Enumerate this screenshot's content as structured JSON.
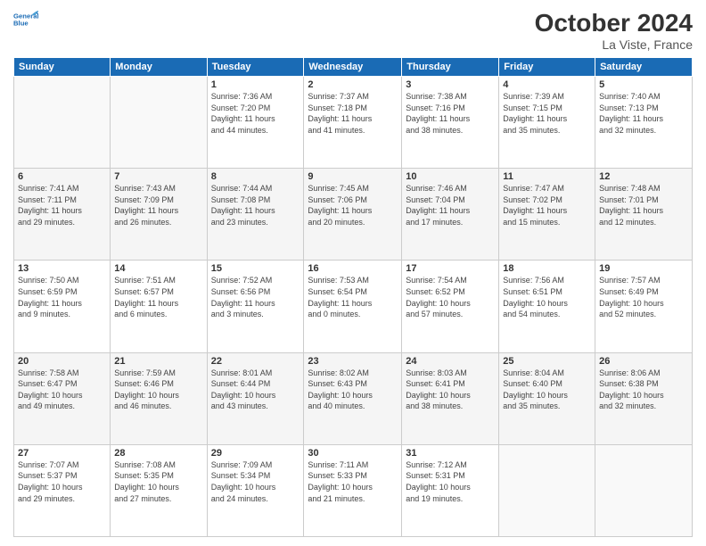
{
  "header": {
    "logo_line1": "General",
    "logo_line2": "Blue",
    "month": "October 2024",
    "location": "La Viste, France"
  },
  "days_of_week": [
    "Sunday",
    "Monday",
    "Tuesday",
    "Wednesday",
    "Thursday",
    "Friday",
    "Saturday"
  ],
  "weeks": [
    [
      {
        "num": "",
        "detail": ""
      },
      {
        "num": "",
        "detail": ""
      },
      {
        "num": "1",
        "detail": "Sunrise: 7:36 AM\nSunset: 7:20 PM\nDaylight: 11 hours\nand 44 minutes."
      },
      {
        "num": "2",
        "detail": "Sunrise: 7:37 AM\nSunset: 7:18 PM\nDaylight: 11 hours\nand 41 minutes."
      },
      {
        "num": "3",
        "detail": "Sunrise: 7:38 AM\nSunset: 7:16 PM\nDaylight: 11 hours\nand 38 minutes."
      },
      {
        "num": "4",
        "detail": "Sunrise: 7:39 AM\nSunset: 7:15 PM\nDaylight: 11 hours\nand 35 minutes."
      },
      {
        "num": "5",
        "detail": "Sunrise: 7:40 AM\nSunset: 7:13 PM\nDaylight: 11 hours\nand 32 minutes."
      }
    ],
    [
      {
        "num": "6",
        "detail": "Sunrise: 7:41 AM\nSunset: 7:11 PM\nDaylight: 11 hours\nand 29 minutes."
      },
      {
        "num": "7",
        "detail": "Sunrise: 7:43 AM\nSunset: 7:09 PM\nDaylight: 11 hours\nand 26 minutes."
      },
      {
        "num": "8",
        "detail": "Sunrise: 7:44 AM\nSunset: 7:08 PM\nDaylight: 11 hours\nand 23 minutes."
      },
      {
        "num": "9",
        "detail": "Sunrise: 7:45 AM\nSunset: 7:06 PM\nDaylight: 11 hours\nand 20 minutes."
      },
      {
        "num": "10",
        "detail": "Sunrise: 7:46 AM\nSunset: 7:04 PM\nDaylight: 11 hours\nand 17 minutes."
      },
      {
        "num": "11",
        "detail": "Sunrise: 7:47 AM\nSunset: 7:02 PM\nDaylight: 11 hours\nand 15 minutes."
      },
      {
        "num": "12",
        "detail": "Sunrise: 7:48 AM\nSunset: 7:01 PM\nDaylight: 11 hours\nand 12 minutes."
      }
    ],
    [
      {
        "num": "13",
        "detail": "Sunrise: 7:50 AM\nSunset: 6:59 PM\nDaylight: 11 hours\nand 9 minutes."
      },
      {
        "num": "14",
        "detail": "Sunrise: 7:51 AM\nSunset: 6:57 PM\nDaylight: 11 hours\nand 6 minutes."
      },
      {
        "num": "15",
        "detail": "Sunrise: 7:52 AM\nSunset: 6:56 PM\nDaylight: 11 hours\nand 3 minutes."
      },
      {
        "num": "16",
        "detail": "Sunrise: 7:53 AM\nSunset: 6:54 PM\nDaylight: 11 hours\nand 0 minutes."
      },
      {
        "num": "17",
        "detail": "Sunrise: 7:54 AM\nSunset: 6:52 PM\nDaylight: 10 hours\nand 57 minutes."
      },
      {
        "num": "18",
        "detail": "Sunrise: 7:56 AM\nSunset: 6:51 PM\nDaylight: 10 hours\nand 54 minutes."
      },
      {
        "num": "19",
        "detail": "Sunrise: 7:57 AM\nSunset: 6:49 PM\nDaylight: 10 hours\nand 52 minutes."
      }
    ],
    [
      {
        "num": "20",
        "detail": "Sunrise: 7:58 AM\nSunset: 6:47 PM\nDaylight: 10 hours\nand 49 minutes."
      },
      {
        "num": "21",
        "detail": "Sunrise: 7:59 AM\nSunset: 6:46 PM\nDaylight: 10 hours\nand 46 minutes."
      },
      {
        "num": "22",
        "detail": "Sunrise: 8:01 AM\nSunset: 6:44 PM\nDaylight: 10 hours\nand 43 minutes."
      },
      {
        "num": "23",
        "detail": "Sunrise: 8:02 AM\nSunset: 6:43 PM\nDaylight: 10 hours\nand 40 minutes."
      },
      {
        "num": "24",
        "detail": "Sunrise: 8:03 AM\nSunset: 6:41 PM\nDaylight: 10 hours\nand 38 minutes."
      },
      {
        "num": "25",
        "detail": "Sunrise: 8:04 AM\nSunset: 6:40 PM\nDaylight: 10 hours\nand 35 minutes."
      },
      {
        "num": "26",
        "detail": "Sunrise: 8:06 AM\nSunset: 6:38 PM\nDaylight: 10 hours\nand 32 minutes."
      }
    ],
    [
      {
        "num": "27",
        "detail": "Sunrise: 7:07 AM\nSunset: 5:37 PM\nDaylight: 10 hours\nand 29 minutes."
      },
      {
        "num": "28",
        "detail": "Sunrise: 7:08 AM\nSunset: 5:35 PM\nDaylight: 10 hours\nand 27 minutes."
      },
      {
        "num": "29",
        "detail": "Sunrise: 7:09 AM\nSunset: 5:34 PM\nDaylight: 10 hours\nand 24 minutes."
      },
      {
        "num": "30",
        "detail": "Sunrise: 7:11 AM\nSunset: 5:33 PM\nDaylight: 10 hours\nand 21 minutes."
      },
      {
        "num": "31",
        "detail": "Sunrise: 7:12 AM\nSunset: 5:31 PM\nDaylight: 10 hours\nand 19 minutes."
      },
      {
        "num": "",
        "detail": ""
      },
      {
        "num": "",
        "detail": ""
      }
    ]
  ]
}
